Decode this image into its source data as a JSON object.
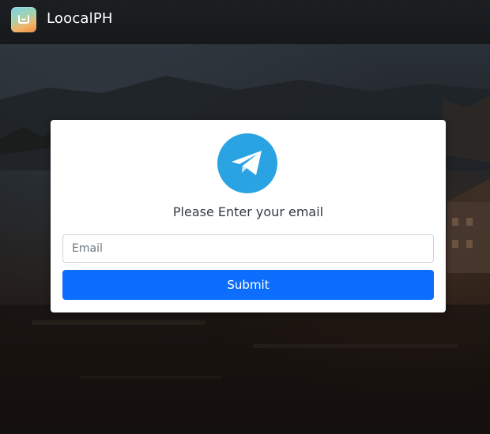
{
  "app": {
    "title": "LoocalPH",
    "icon": "app-logo-icon"
  },
  "card": {
    "logo_icon": "telegram-paper-plane-icon",
    "logo_color": "#2aa3e2",
    "prompt": "Please Enter your email",
    "email": {
      "placeholder": "Email",
      "value": ""
    },
    "submit_label": "Submit",
    "submit_color": "#0d6efd"
  }
}
